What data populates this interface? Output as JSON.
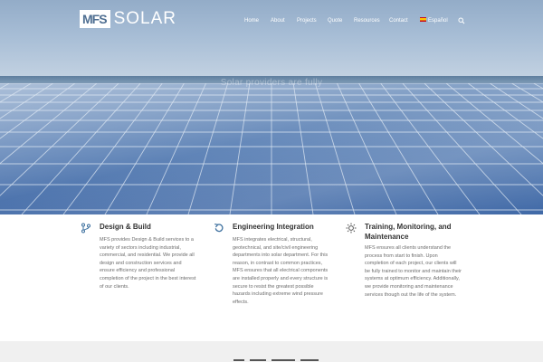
{
  "brand": {
    "logo_box": "MFS",
    "logo_word": "SOLAR",
    "accent": "#3c6f9e"
  },
  "nav": {
    "items": [
      {
        "label": "Home"
      },
      {
        "label": "About"
      },
      {
        "label": "Projects"
      },
      {
        "label": "Quote"
      },
      {
        "label": "Resources"
      },
      {
        "label": "Contact"
      },
      {
        "label": "Español"
      }
    ],
    "search_icon": "search-icon"
  },
  "hero": {
    "tagline": "Solar providers are fully"
  },
  "features": [
    {
      "icon": "project-branch-icon",
      "title": "Design & Build",
      "text": "MFS provides Design & Build services to a variety of sectors including industrial, commercial, and residential. We provide all design and construction services and ensure efficiency and professional completion of the project in the best interest of our clients."
    },
    {
      "icon": "refresh-icon",
      "title": "Engineering Integration",
      "text": "MFS integrates electrical, structural, geotechnical, and site/civil engineering departments into solar department. For this reason, in contrast to common practices, MFS ensures that all electrical components are installed properly and every structure is secure to resist the greatest possible hazards including extreme wind pressure effects."
    },
    {
      "icon": "sun-icon",
      "title_line1": "Training, Monitoring, and",
      "title_line2": "Maintenance",
      "text": "MFS ensures all clients understand the process from start to finish. Upon completion of each project, our clients will be fully trained to monitor and maintain their systems at optimum efficiency. Additionally, we provide monitoring and maintenance services though out the life of the system."
    }
  ]
}
